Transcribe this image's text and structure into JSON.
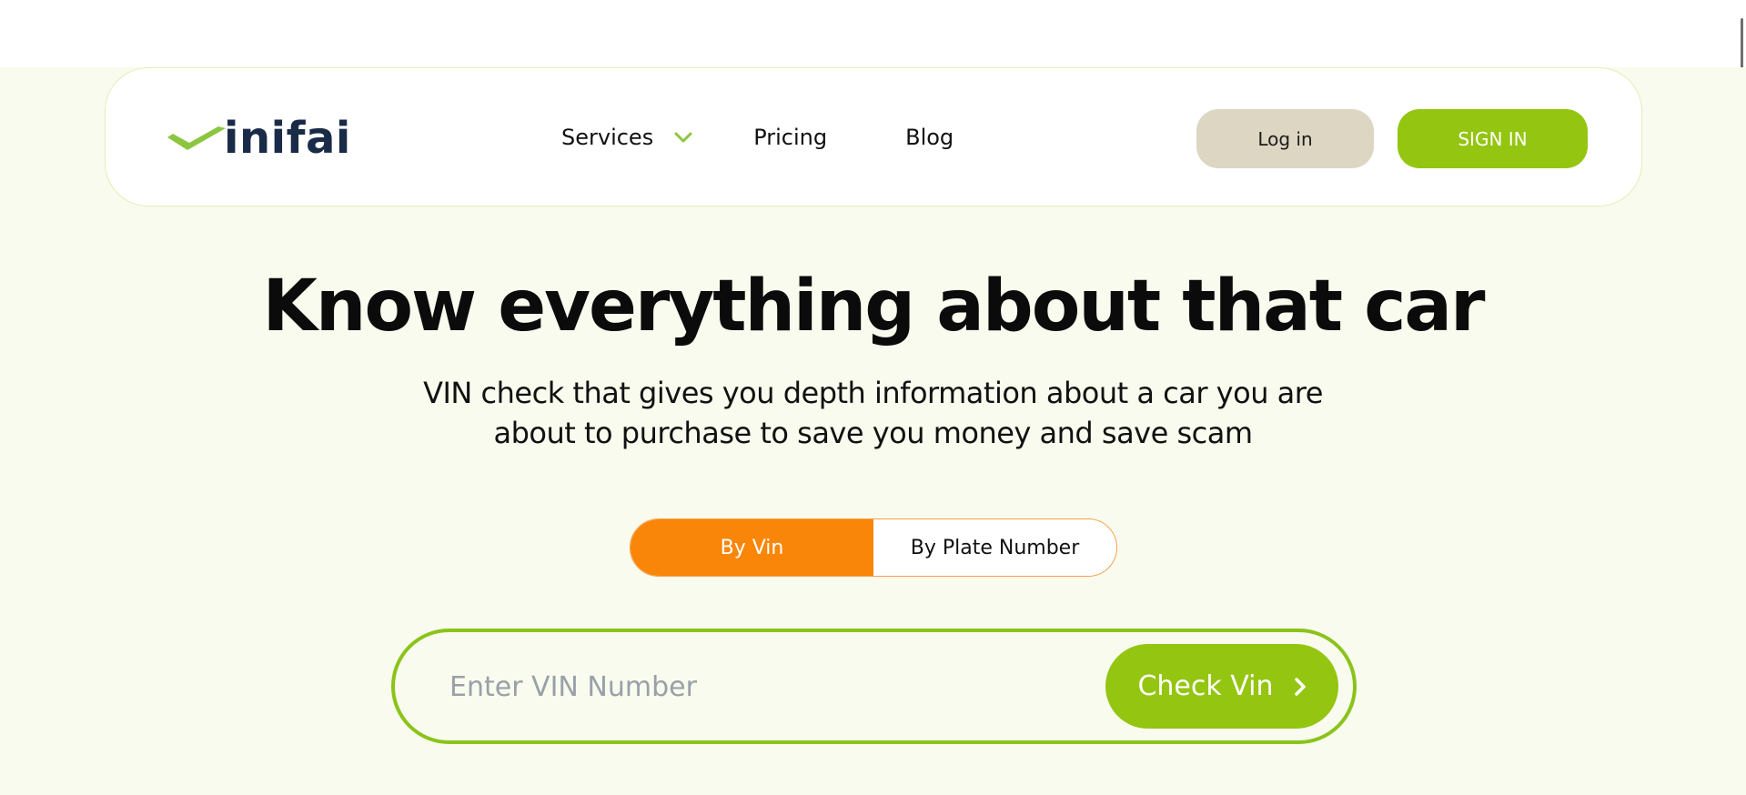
{
  "brand": {
    "name": "inifai",
    "logo_icon": "checkmark-v-logo",
    "text_color": "#1a2b47",
    "accent_green": "#94c511",
    "accent_orange": "#f98608"
  },
  "nav": {
    "items": [
      {
        "label": "Services",
        "icon": "chevron-down-icon"
      },
      {
        "label": "Pricing"
      },
      {
        "label": "Blog"
      }
    ],
    "login_label": "Log in",
    "signin_label": "SIGN IN"
  },
  "hero": {
    "title": "Know everything about that car",
    "subtitle_line1": "VIN check that gives you depth information about a car you are",
    "subtitle_line2": "about to purchase to save you money and save scam"
  },
  "search_mode": {
    "options": [
      {
        "label": "By Vin",
        "active": true
      },
      {
        "label": "By Plate Number",
        "active": false
      }
    ]
  },
  "search": {
    "placeholder": "Enter VIN Number",
    "value": "",
    "button_label": "Check Vin",
    "button_icon": "chevron-right-icon"
  }
}
